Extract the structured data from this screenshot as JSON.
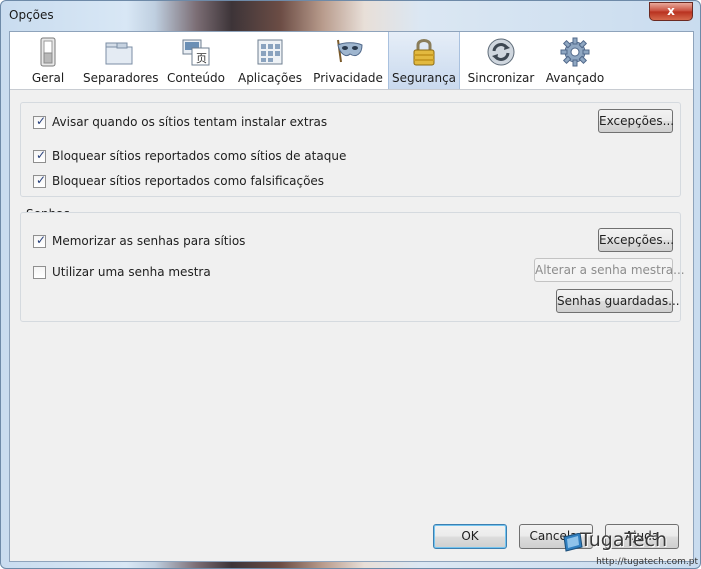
{
  "window": {
    "title": "Opções",
    "close_label": "x"
  },
  "toolbar": {
    "panes": [
      {
        "label": "Geral",
        "icon": "switch-icon"
      },
      {
        "label": "Separadores",
        "icon": "folder-tabs-icon"
      },
      {
        "label": "Conteúdo",
        "icon": "content-icon"
      },
      {
        "label": "Aplicações",
        "icon": "applications-icon"
      },
      {
        "label": "Privacidade",
        "icon": "mask-icon"
      },
      {
        "label": "Segurança",
        "icon": "padlock-icon",
        "selected": true
      },
      {
        "label": "Sincronizar",
        "icon": "sync-icon"
      },
      {
        "label": "Avançado",
        "icon": "gear-icon"
      }
    ]
  },
  "security": {
    "warn_addons": {
      "label": "Avisar quando os sítios tentam instalar extras",
      "checked": true
    },
    "exceptions_label": "Excepções...",
    "block_attack": {
      "label": "Bloquear sítios reportados como sítios de ataque",
      "checked": true
    },
    "block_forgery": {
      "label": "Bloquear sítios reportados como falsificações",
      "checked": true
    }
  },
  "passwords": {
    "caption": "Senhas",
    "remember": {
      "label": "Memorizar as senhas para sítios",
      "checked": true
    },
    "exceptions_label": "Excepções...",
    "master": {
      "label": "Utilizar uma senha mestra",
      "checked": false
    },
    "change_master_label": "Alterar a senha mestra...",
    "saved_label": "Senhas guardadas..."
  },
  "footer": {
    "ok_label": "OK",
    "cancel_label": "Cancelar",
    "help_label": "Ajuda"
  },
  "watermark": {
    "logo": "TugaTech",
    "url": "http://tugatech.com.pt"
  },
  "colors": {
    "accent": "#c9d9ee",
    "check": "#27407c"
  }
}
